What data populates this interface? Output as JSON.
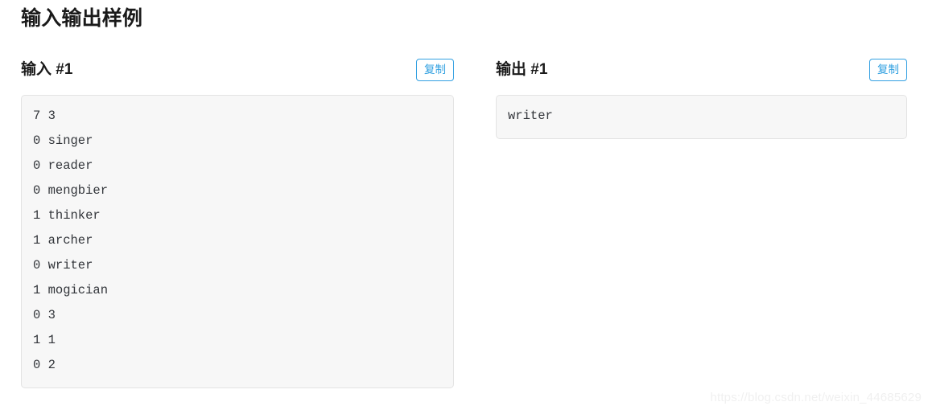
{
  "page": {
    "title": "输入输出样例",
    "watermark": "https://blog.csdn.net/weixin_44685629"
  },
  "samples": {
    "input": {
      "heading": "输入 #1",
      "copy_label": "复制",
      "content": "7 3\n0 singer\n0 reader\n0 mengbier\n1 thinker\n1 archer\n0 writer\n1 mogician\n0 3\n1 1\n0 2",
      "lines": [
        "7 3",
        "0 singer",
        "0 reader",
        "0 mengbier",
        "1 thinker",
        "1 archer",
        "0 writer",
        "1 mogician",
        "0 3",
        "1 1",
        "0 2"
      ]
    },
    "output": {
      "heading": "输出 #1",
      "copy_label": "复制",
      "content": "writer",
      "lines": [
        "writer"
      ]
    }
  },
  "colors": {
    "accent": "#33a0e2",
    "code_background": "#f7f7f7",
    "code_border": "#e3e3e3",
    "text": "#32353a",
    "heading": "#1a1a1a",
    "watermark": "#f0f0f0"
  }
}
